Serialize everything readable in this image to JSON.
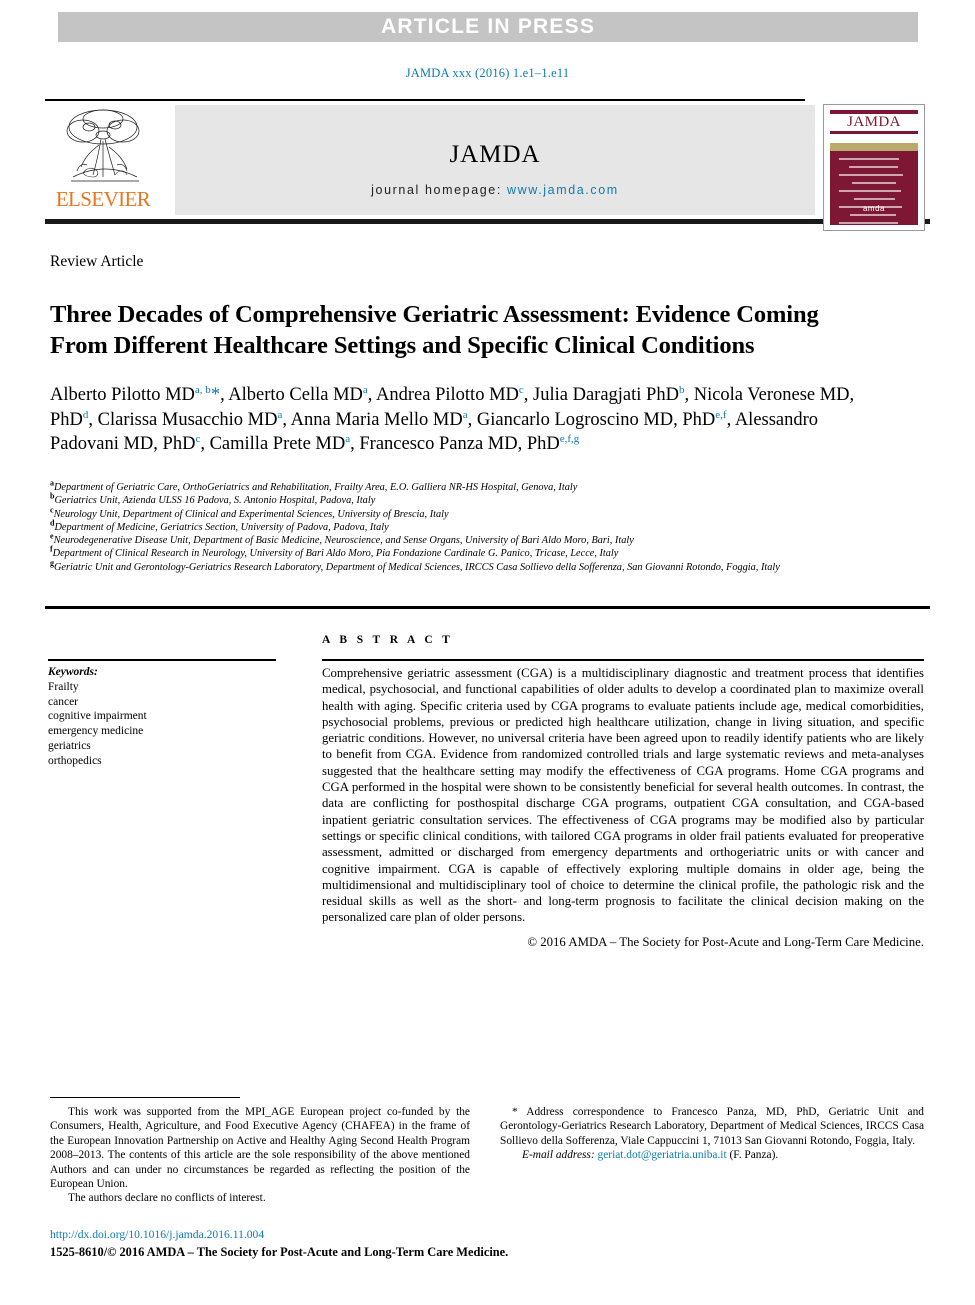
{
  "banner": {
    "text": "ARTICLE IN PRESS"
  },
  "running_citation": "JAMDA xxx (2016) 1.e1–1.e11",
  "masthead": {
    "publisher": "ELSEVIER",
    "journal_wordmark": "JAMDA",
    "homepage_label": "journal homepage:",
    "homepage_url": "www.jamda.com",
    "cover_title": "JAMDA",
    "cover_logo": "amda"
  },
  "article": {
    "type": "Review Article",
    "title": "Three Decades of Comprehensive Geriatric Assessment: Evidence Coming From Different Healthcare Settings and Specific Clinical Conditions",
    "authors_html": "Alberto Pilotto MD<sup>a, b</sup><span class=\"star\">*</span>, Alberto Cella MD<sup>a</sup>, Andrea Pilotto MD<sup>c</sup>, Julia Daragjati PhD<sup>b</sup>, Nicola Veronese MD, PhD<sup>d</sup>, Clarissa Musacchio MD<sup>a</sup>, Anna Maria Mello MD<sup>a</sup>, Giancarlo Logroscino MD, PhD<sup>e,f</sup>, Alessandro Padovani MD, PhD<sup>c</sup>, Camilla Prete MD<sup>a</sup>, Francesco Panza MD, PhD<sup>e,f,g</sup>",
    "affiliations": [
      {
        "marker": "a",
        "text": "Department of Geriatric Care, OrthoGeriatrics and Rehabilitation, Frailty Area, E.O. Galliera NR-HS Hospital, Genova, Italy"
      },
      {
        "marker": "b",
        "text": "Geriatrics Unit, Azienda ULSS 16 Padova, S. Antonio Hospital, Padova, Italy"
      },
      {
        "marker": "c",
        "text": "Neurology Unit, Department of Clinical and Experimental Sciences, University of Brescia, Italy"
      },
      {
        "marker": "d",
        "text": "Department of Medicine, Geriatrics Section, University of Padova, Padova, Italy"
      },
      {
        "marker": "e",
        "text": "Neurodegenerative Disease Unit, Department of Basic Medicine, Neuroscience, and Sense Organs, University of Bari Aldo Moro, Bari, Italy"
      },
      {
        "marker": "f",
        "text": "Department of Clinical Research in Neurology, University of Bari Aldo Moro, Pia Fondazione Cardinale G. Panico, Tricase, Lecce, Italy"
      },
      {
        "marker": "g",
        "text": "Geriatric Unit and Gerontology-Geriatrics Research Laboratory, Department of Medical Sciences, IRCCS Casa Sollievo della Sofferenza, San Giovanni Rotondo, Foggia, Italy"
      }
    ]
  },
  "keywords": {
    "heading": "Keywords:",
    "items": [
      "Frailty",
      "cancer",
      "cognitive impairment",
      "emergency medicine",
      "geriatrics",
      "orthopedics"
    ]
  },
  "abstract": {
    "label": "A B S T R A C T",
    "body": "Comprehensive geriatric assessment (CGA) is a multidisciplinary diagnostic and treatment process that identifies medical, psychosocial, and functional capabilities of older adults to develop a coordinated plan to maximize overall health with aging. Specific criteria used by CGA programs to evaluate patients include age, medical comorbidities, psychosocial problems, previous or predicted high healthcare utilization, change in living situation, and specific geriatric conditions. However, no universal criteria have been agreed upon to readily identify patients who are likely to benefit from CGA. Evidence from randomized controlled trials and large systematic reviews and meta-analyses suggested that the healthcare setting may modify the effectiveness of CGA programs. Home CGA programs and CGA performed in the hospital were shown to be consistently beneficial for several health outcomes. In contrast, the data are conflicting for posthospital discharge CGA programs, outpatient CGA consultation, and CGA-based inpatient geriatric consultation services. The effectiveness of CGA programs may be modified also by particular settings or specific clinical conditions, with tailored CGA programs in older frail patients evaluated for preoperative assessment, admitted or discharged from emergency departments and orthogeriatric units or with cancer and cognitive impairment. CGA is capable of effectively exploring multiple domains in older age, being the multidimensional and multidisciplinary tool of choice to determine the clinical profile, the pathologic risk and the residual skills as well as the short- and long-term prognosis to facilitate the clinical decision making on the personalized care plan of older persons.",
    "copyright": "© 2016 AMDA – The Society for Post-Acute and Long-Term Care Medicine."
  },
  "footnotes": {
    "funding": "This work was supported from the MPI_AGE European project co-funded by the Consumers, Health, Agriculture, and Food Executive Agency (CHAFEA) in the frame of the European Innovation Partnership on Active and Healthy Aging Second Health Program 2008–2013. The contents of this article are the sole responsibility of the above mentioned Authors and can under no circumstances be regarded as reflecting the position of the European Union.",
    "conflicts": "The authors declare no conflicts of interest.",
    "correspondence": "* Address correspondence to Francesco Panza, MD, PhD, Geriatric Unit and Gerontology-Geriatrics Research Laboratory, Department of Medical Sciences, IRCCS Casa Sollievo della Sofferenza, Viale Cappuccini 1, 71013 San Giovanni Rotondo, Foggia, Italy.",
    "email_label": "E-mail address:",
    "email": "geriat.dot@geriatria.uniba.it",
    "email_owner": "(F. Panza)."
  },
  "footer": {
    "doi": "http://dx.doi.org/10.1016/j.jamda.2016.11.004",
    "issn_copyright": "1525-8610/© 2016 AMDA – The Society for Post-Acute and Long-Term Care Medicine."
  },
  "colors": {
    "link": "#0f7bb0",
    "banner_bg": "#c4c4c4",
    "elsevier_orange": "#e87722",
    "cover_maroon": "#7d1733"
  }
}
